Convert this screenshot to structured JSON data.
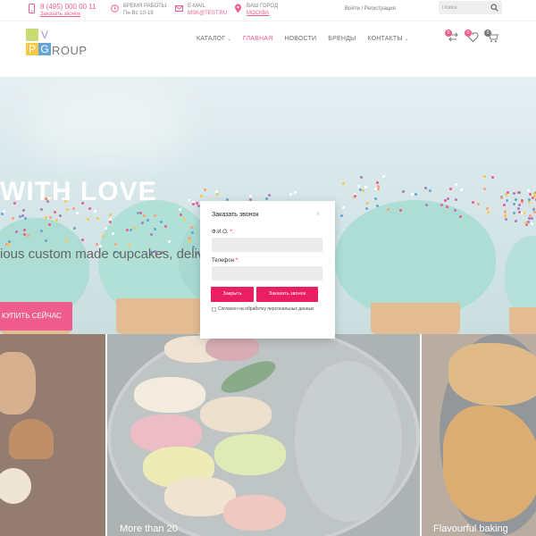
{
  "topbar": {
    "phone": {
      "number": "8 (495) 000 00 11",
      "callback_link": "Заказать звонок"
    },
    "hours": {
      "label": "Время работы:",
      "value": "Пн-Вс 10-19"
    },
    "email": {
      "label": "E-mail",
      "value": "msk@test.ru"
    },
    "city": {
      "label": "Ваш город",
      "value": "Москва"
    },
    "login": "Войти / Регистрация",
    "search": {
      "placeholder": "Поиск"
    }
  },
  "logo": {
    "letter_v": "V",
    "letter_p": "P",
    "letter_g": "G",
    "text": "ROUP"
  },
  "nav": {
    "items": [
      {
        "label": "Каталог",
        "has_chevron": true
      },
      {
        "label": "Главная",
        "active": true
      },
      {
        "label": "Новости"
      },
      {
        "label": "Бренды"
      },
      {
        "label": "Контакты",
        "has_chevron": true
      }
    ]
  },
  "header_icons": {
    "compare_count": "0",
    "wishlist_count": "0",
    "cart_count": "0"
  },
  "hero": {
    "title": "WITH LOVE",
    "subtitle": "ious custom made cupcakes, deliver",
    "cta_label": "Купить сейчас"
  },
  "tiles": [
    {
      "label": ""
    },
    {
      "label": "More than 20"
    },
    {
      "label": "Flavourful baking"
    }
  ],
  "modal": {
    "title": "Заказать звонок",
    "close_symbol": "×",
    "name_label": "Ф.И.О.",
    "phone_label": "Телефон",
    "required_mark": "*:",
    "close_button": "Закрыть",
    "submit_button": "Заказать звонок",
    "consent_label": "Согласен на обработку персональных данных"
  },
  "colors": {
    "accent": "#e91e63",
    "hero_frosting": "#8fd0c3"
  }
}
